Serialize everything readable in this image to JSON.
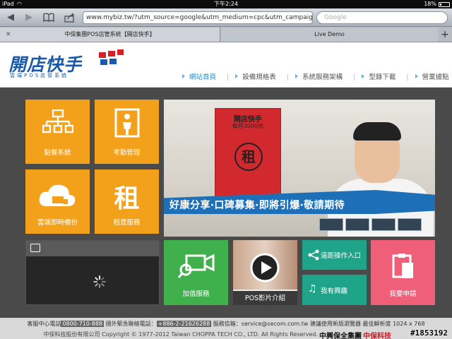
{
  "status_bar": {
    "device": "iPad",
    "time": "下午2:24",
    "battery": "18%"
  },
  "browser": {
    "url": "www.mybiz.tw/?utm_source=google&utm_medium=cpc&utm_campaign=",
    "search_placeholder": "Google",
    "tabs": [
      {
        "label": "中保集團POS店管系統【開店快手】"
      },
      {
        "label": "Live Demo"
      }
    ],
    "new_tab_label": "+"
  },
  "site": {
    "logo_title": "開店快手",
    "logo_sub": "雲端POS店管系統",
    "nav": [
      "網站首頁",
      "設備規格表",
      "系統服務架構",
      "型錄下載",
      "營業據點"
    ],
    "active_nav": 0
  },
  "tiles": {
    "pos": "點餐系統",
    "attendance": "考勤管理",
    "backup": "雲端即時備份",
    "rent_char": "租",
    "rent": "租賃服務",
    "addon": "加值服務",
    "video_intro": "POS影片介紹",
    "remote": "遠距操作入口",
    "interest": "我有興趣",
    "apply": "我要申請"
  },
  "hero": {
    "poster_title": "開店快手",
    "poster_price": "每月3000元",
    "poster_char": "租",
    "banner_text": "好康分享‧口碑募集‧即將引爆‧敬請期待"
  },
  "footer": {
    "line1_prefix": "客服中心電話",
    "service_phone": "0800-710-888",
    "line1_mid": "國外緊急聯絡電話：",
    "intl_phone": "+886-2-21626288",
    "line1_suffix": "服務信箱：service@secom.com.tw 建議使用新版瀏覽器 最佳解析度 1024 x 768",
    "line2": "中保科技股份有限公司 Copyright © 1977-2012 Taiwan CHOPPA TECH CO., LTD. All Rights Reserved.",
    "corp_a": "中興保全集團",
    "corp_b": "中保科技"
  },
  "watermark": "#1853192",
  "colors": {
    "orange": "#f3a01a",
    "green": "#3fb04c",
    "teal": "#1fa48a",
    "pink": "#ef5f78",
    "brand_blue": "#1a5aa8"
  }
}
